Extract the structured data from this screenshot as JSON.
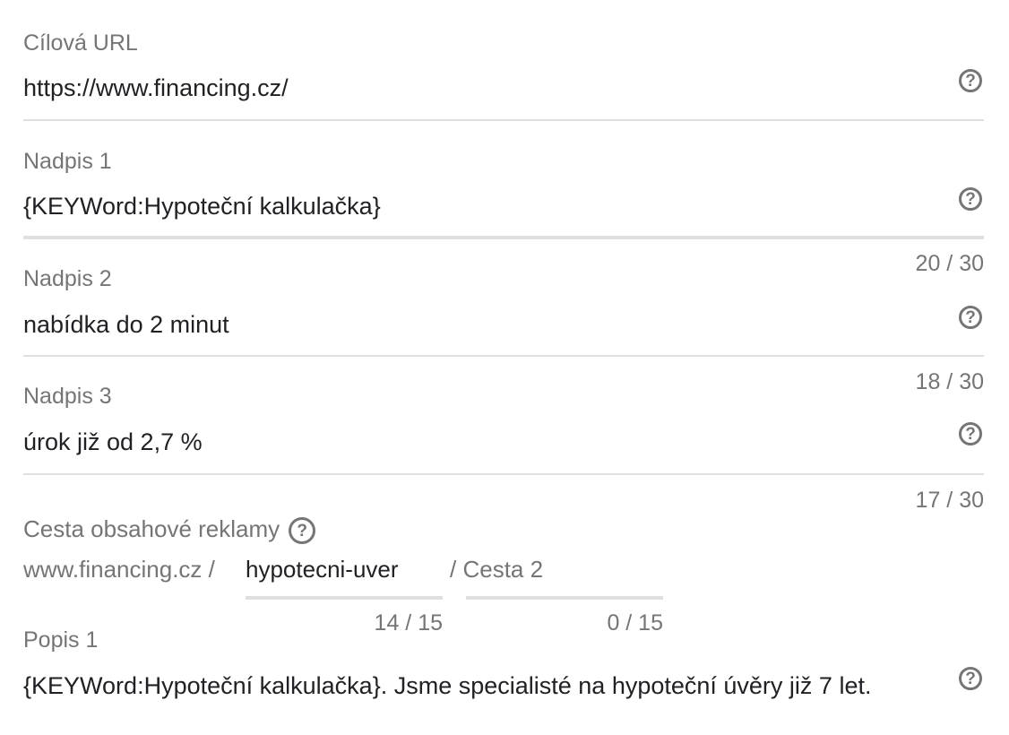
{
  "target_url": {
    "label": "Cílová URL",
    "value": "https://www.financing.cz/",
    "help_icon": "help-circle-icon"
  },
  "headline1": {
    "label": "Nadpis 1",
    "value": "{KEYWord:Hypoteční kalkulačka}",
    "counter": "20 / 30",
    "help_icon": "help-circle-icon"
  },
  "headline2": {
    "label": "Nadpis 2",
    "value": "nabídka do 2 minut",
    "counter": "18 / 30",
    "help_icon": "help-circle-icon"
  },
  "headline3": {
    "label": "Nadpis 3",
    "value": "úrok již od 2,7 %",
    "counter": "17 / 30",
    "help_icon": "help-circle-icon"
  },
  "display_path": {
    "label": "Cesta obsahové reklamy",
    "help_icon": "help-circle-icon",
    "base": "www.financing.cz /",
    "path1_value": "hypotecni-uver",
    "path1_counter": "14 / 15",
    "path2_separator": "/",
    "path2_placeholder": "Cesta 2",
    "path2_counter": "0 / 15"
  },
  "description1": {
    "label": "Popis 1",
    "value": "{KEYWord:Hypoteční kalkulačka}. Jsme specialisté na hypoteční úvěry již 7 let.",
    "help_icon": "help-circle-icon"
  },
  "colors": {
    "text": "#202124",
    "label": "#757575",
    "divider": "#e0e0e0"
  }
}
